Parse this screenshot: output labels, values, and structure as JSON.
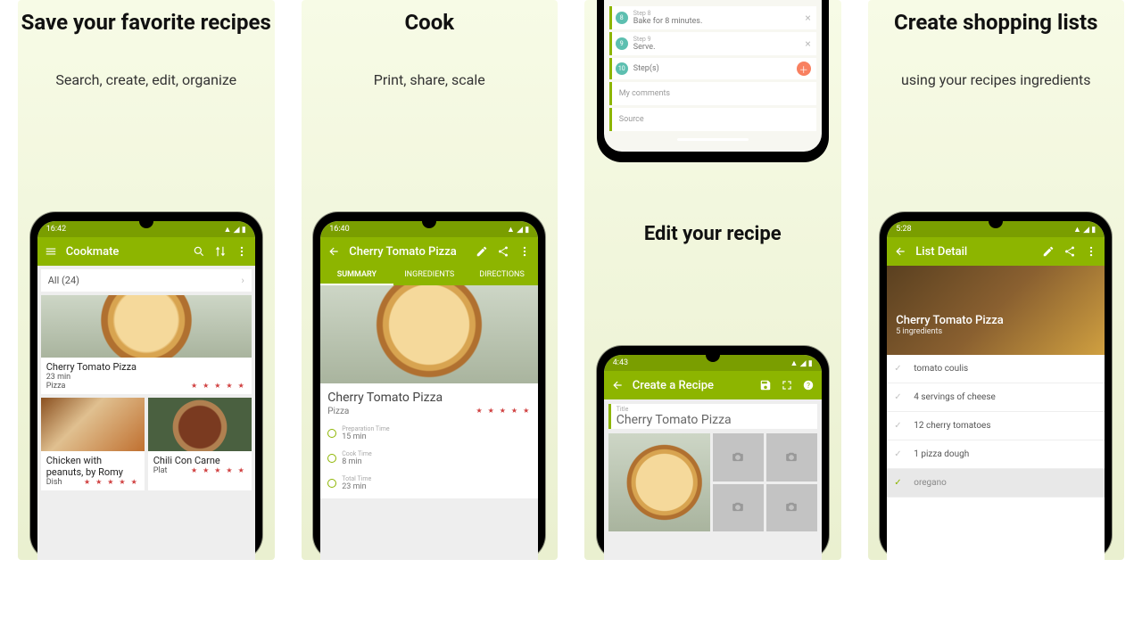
{
  "panel1": {
    "title": "Save your favorite recipes",
    "subtitle": "Search, create, edit, organize",
    "status_time": "16:42",
    "app_title": "Cookmate",
    "filter": "All (24)",
    "recipe1": {
      "title": "Cherry Tomato Pizza",
      "meta": "23 min",
      "category": "Pizza"
    },
    "recipe2": {
      "title": "Chicken with peanuts, by Romy",
      "category": "Dish"
    },
    "recipe3": {
      "title": "Chili Con Carne",
      "category": "Plat"
    }
  },
  "panel2": {
    "title": "Cook",
    "subtitle": "Print, share, scale",
    "status_time": "16:40",
    "app_title": "Cherry Tomato Pizza",
    "tabs": {
      "summary": "SUMMARY",
      "ingredients": "INGREDIENTS",
      "directions": "DIRECTIONS"
    },
    "recipe_title": "Cherry Tomato Pizza",
    "recipe_category": "Pizza",
    "stars": "★ ★ ★ ★ ★",
    "prep_label": "Preparation Time",
    "prep_value": "15 min",
    "cook_label": "Cook Time",
    "cook_value": "8 min",
    "total_label": "Total Time",
    "total_value": "23 min"
  },
  "panel3": {
    "step8_label": "Step 8",
    "step8_text": "Bake for 8 minutes.",
    "step9_label": "Step 9",
    "step9_text": "Serve.",
    "step_add": "Step(s)",
    "comments": "My comments",
    "source": "Source",
    "mid_title": "Edit your recipe",
    "status_time": "4:43",
    "app_title": "Create a Recipe",
    "title_label": "Title",
    "title_value": "Cherry Tomato Pizza"
  },
  "panel4": {
    "title": "Create shopping lists",
    "subtitle": "using your recipes ingredients",
    "status_time": "5:28",
    "app_title": "List Detail",
    "hero_title": "Cherry Tomato Pizza",
    "hero_sub": "5 ingredients",
    "items": {
      "i1": "tomato coulis",
      "i2": "4 servings of cheese",
      "i3": "12 cherry tomatoes",
      "i4": "1 pizza dough",
      "i5": "oregano"
    }
  }
}
